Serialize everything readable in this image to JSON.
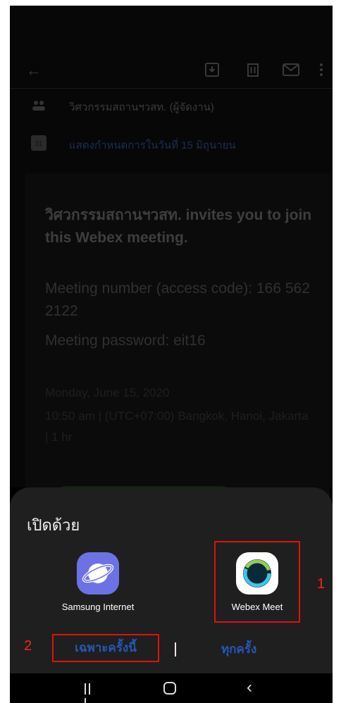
{
  "appbar": {
    "icons": [
      "back-arrow-icon",
      "archive-icon",
      "trash-icon",
      "mail-icon",
      "more-vert-icon"
    ]
  },
  "email": {
    "organizer": "วิศวกรรมสถานฯวสท. (ผู้จัดงาน)",
    "calendar_link": "แสดงกำหนดการในวันที่ 15 มิถุนายน",
    "card_title": "วิศวกรรมสถานฯวสท. invites you to join this Webex meeting.",
    "meeting_number": "Meeting number (access code): 166 562 2122",
    "meeting_password": "Meeting password: eit16",
    "date": "Monday, June 15, 2020",
    "time": "10:50 am | (UTC+07:00) Bangkok, Hanoi, Jakarta | 1 hr"
  },
  "sheet": {
    "title": "เปิดด้วย",
    "apps": [
      {
        "label": "Samsung Internet",
        "icon": "samsung-internet-icon",
        "color": "#6c72e6"
      },
      {
        "label": "Webex Meet",
        "icon": "webex-meet-icon",
        "color": "#ffffff"
      }
    ],
    "just_once": "เฉพาะครั้งนี้",
    "always": "ทุกครั้ง",
    "callouts": [
      "1",
      "2"
    ],
    "accent_color": "#2457b8",
    "highlight_color": "#e01010"
  },
  "navbar": {
    "icons": [
      "recent-apps-icon",
      "home-icon",
      "back-icon"
    ]
  }
}
